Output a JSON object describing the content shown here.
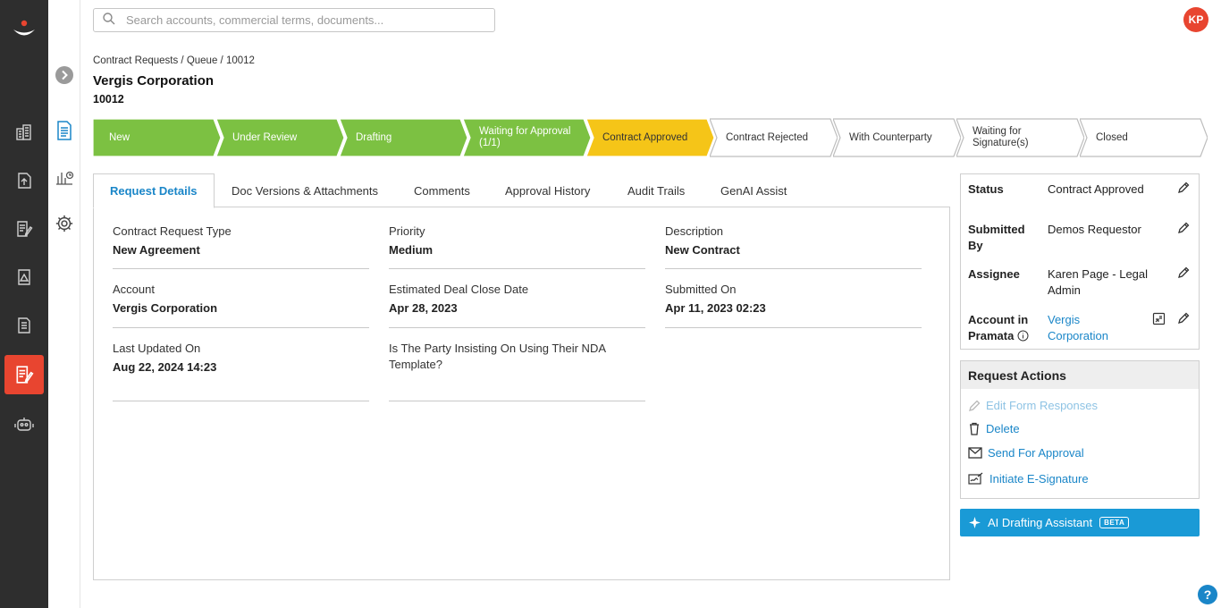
{
  "search": {
    "placeholder": "Search accounts, commercial terms, documents..."
  },
  "user": {
    "initials": "KP"
  },
  "breadcrumb": "Contract Requests / Queue / 10012",
  "page": {
    "title": "Vergis Corporation",
    "id": "10012"
  },
  "steps": [
    {
      "label": "New",
      "state": "done"
    },
    {
      "label": "Under Review",
      "state": "done"
    },
    {
      "label": "Drafting",
      "state": "done"
    },
    {
      "label": "Waiting for Approval (1/1)",
      "state": "done"
    },
    {
      "label": "Contract Approved",
      "state": "current"
    },
    {
      "label": "Contract Rejected",
      "state": "todo"
    },
    {
      "label": "With Counterparty",
      "state": "todo"
    },
    {
      "label": "Waiting for Signature(s)",
      "state": "todo"
    },
    {
      "label": "Closed",
      "state": "todo"
    }
  ],
  "tabs": [
    {
      "label": "Request Details"
    },
    {
      "label": "Doc Versions & Attachments"
    },
    {
      "label": "Comments"
    },
    {
      "label": "Approval History"
    },
    {
      "label": "Audit Trails"
    },
    {
      "label": "GenAI Assist"
    }
  ],
  "fields": [
    {
      "label": "Contract Request Type",
      "value": "New Agreement"
    },
    {
      "label": "Priority",
      "value": "Medium"
    },
    {
      "label": "Description",
      "value": "New Contract"
    },
    {
      "label": "Account",
      "value": "Vergis Corporation"
    },
    {
      "label": "Estimated Deal Close Date",
      "value": "Apr 28, 2023"
    },
    {
      "label": "Submitted On",
      "value": "Apr 11, 2023 02:23"
    },
    {
      "label": "Last Updated On",
      "value": "Aug 22, 2024 14:23"
    },
    {
      "label": "Is The Party Insisting On Using Their NDA Template?",
      "value": ""
    }
  ],
  "summary": {
    "status_label": "Status",
    "status_value": "Contract Approved",
    "submitted_label": "Submitted By",
    "submitted_value": "Demos Requestor",
    "assignee_label": "Assignee",
    "assignee_value": "Karen Page - Legal Admin",
    "account_label": "Account in Pramata",
    "account_value": "Vergis Corporation"
  },
  "actions": {
    "title": "Request Actions",
    "edit": "Edit Form Responses",
    "delete": "Delete",
    "send": "Send For Approval",
    "esign": "Initiate E-Signature"
  },
  "ai": {
    "label": "AI Drafting Assistant",
    "badge": "BETA"
  },
  "help": "?",
  "colors": {
    "done": "#7cc142",
    "current": "#f5c518",
    "accent": "#e84530",
    "link": "#1a86c8"
  }
}
